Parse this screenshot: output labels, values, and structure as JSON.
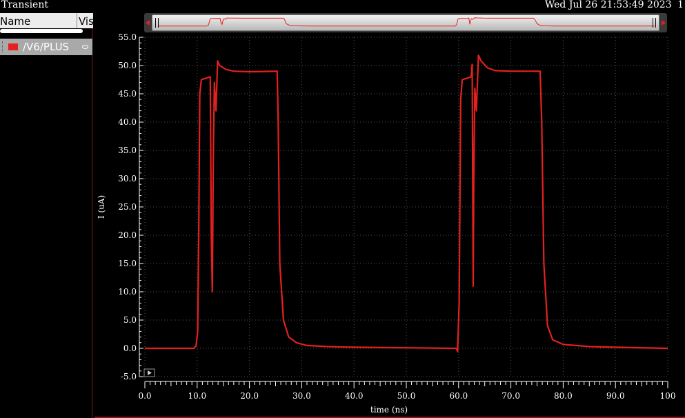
{
  "header": {
    "title": "Transient",
    "datetime": "Wed Jul 26 21:53:49 2023",
    "page_number": "1"
  },
  "browser": {
    "columns": {
      "name": "Name",
      "vis": "Vis"
    },
    "traces": [
      {
        "label": "/V6/PLUS",
        "color": "#e52020",
        "visible_icon": "eye-icon"
      }
    ]
  },
  "colors": {
    "background": "#000000",
    "trace": "#e52020",
    "grid": "#555555",
    "axis": "#ffffff"
  },
  "chart_data": {
    "type": "line",
    "xlabel": "time (ns)",
    "ylabel": "I (uA)",
    "xlim": [
      0,
      100
    ],
    "ylim": [
      -5,
      55
    ],
    "x_ticks": [
      0,
      10,
      20,
      30,
      40,
      50,
      60,
      70,
      80,
      90,
      100
    ],
    "x_tick_labels": [
      "0.0",
      "10.0",
      "20.0",
      "30.0",
      "40.0",
      "50.0",
      "60.0",
      "70.0",
      "80.0",
      "90.0",
      "100"
    ],
    "y_ticks": [
      -5,
      0,
      5,
      10,
      15,
      20,
      25,
      30,
      35,
      40,
      45,
      50,
      55
    ],
    "y_tick_labels": [
      "-5.0",
      "0.0",
      "5.0",
      "10.0",
      "15.0",
      "20.0",
      "25.0",
      "30.0",
      "35.0",
      "40.0",
      "45.0",
      "50.0",
      "55.0"
    ],
    "grid": true,
    "series": [
      {
        "name": "/V6/PLUS",
        "color": "#e52020",
        "points": [
          [
            0,
            0
          ],
          [
            9.4,
            0
          ],
          [
            9.8,
            0.5
          ],
          [
            10.1,
            3
          ],
          [
            10.3,
            20
          ],
          [
            10.5,
            45
          ],
          [
            10.8,
            47.5
          ],
          [
            12.5,
            48
          ],
          [
            12.7,
            20
          ],
          [
            12.9,
            10
          ],
          [
            13.1,
            35
          ],
          [
            13.3,
            47
          ],
          [
            13.6,
            42
          ],
          [
            13.9,
            50.8
          ],
          [
            14.3,
            50
          ],
          [
            15.5,
            49.3
          ],
          [
            17,
            49
          ],
          [
            20,
            48.9
          ],
          [
            25.3,
            49
          ],
          [
            25.5,
            40
          ],
          [
            25.8,
            15
          ],
          [
            26.5,
            5
          ],
          [
            27.5,
            2
          ],
          [
            29,
            1
          ],
          [
            31,
            0.5
          ],
          [
            35,
            0.3
          ],
          [
            40,
            0.2
          ],
          [
            50,
            0.1
          ],
          [
            59,
            0
          ],
          [
            59.6,
            0
          ],
          [
            59.8,
            -0.6
          ],
          [
            60.1,
            8
          ],
          [
            60.4,
            44
          ],
          [
            60.7,
            47.5
          ],
          [
            62.4,
            48
          ],
          [
            62.6,
            50.2
          ],
          [
            62.7,
            28
          ],
          [
            62.8,
            11
          ],
          [
            62.9,
            30
          ],
          [
            63.1,
            46
          ],
          [
            63.4,
            42
          ],
          [
            63.8,
            51.8
          ],
          [
            64.3,
            50.8
          ],
          [
            65.5,
            49.6
          ],
          [
            67,
            49.1
          ],
          [
            70,
            49
          ],
          [
            75.6,
            49
          ],
          [
            75.9,
            40
          ],
          [
            76.3,
            15
          ],
          [
            77,
            4
          ],
          [
            78,
            1.5
          ],
          [
            80,
            0.7
          ],
          [
            85,
            0.3
          ],
          [
            90,
            0.2
          ],
          [
            100,
            0
          ]
        ]
      }
    ]
  }
}
